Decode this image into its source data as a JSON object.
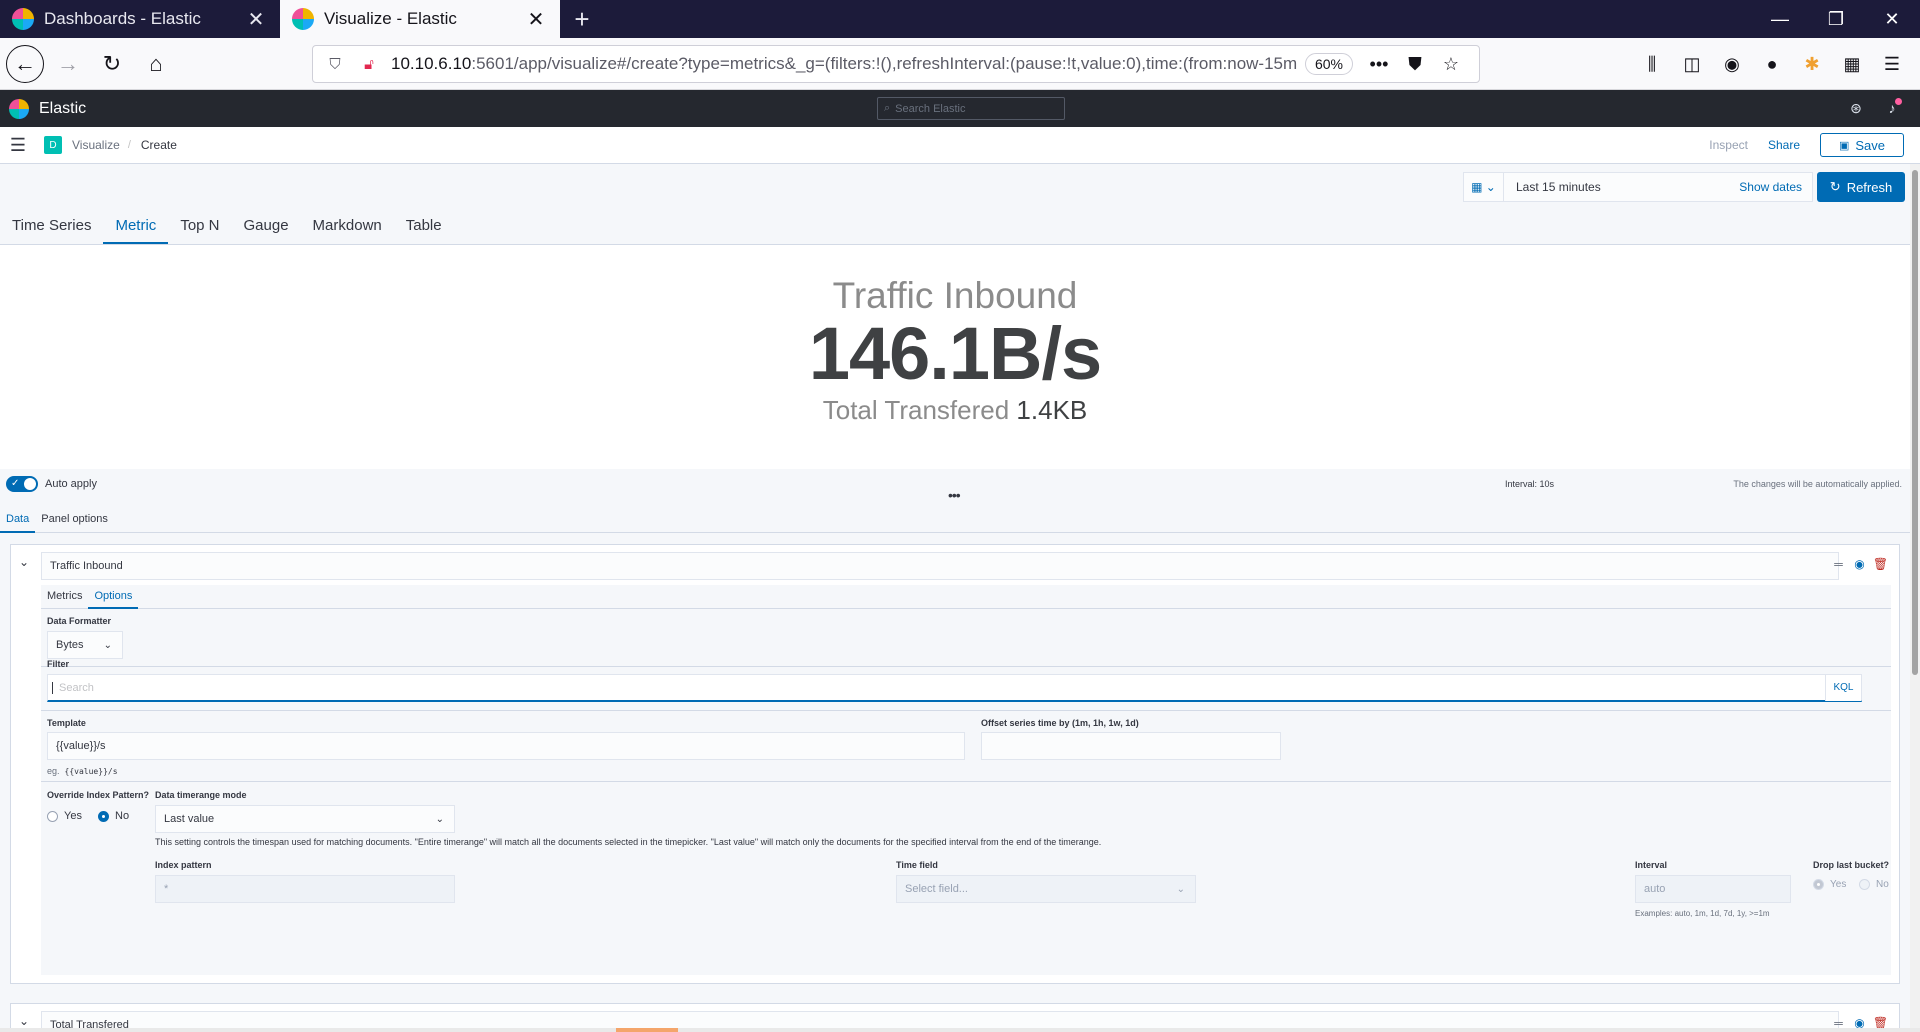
{
  "browser": {
    "tabs": [
      {
        "title": "Dashboards - Elastic",
        "active": false
      },
      {
        "title": "Visualize - Elastic",
        "active": true
      }
    ],
    "new_tab_icon": "plus-icon",
    "url_host": "10.10.6.10",
    "url_rest": ":5601/app/visualize#/create?type=metrics&_g=(filters:!(),refreshInterval:(pause:!t,value:0),time:(from:now-15m",
    "zoom": "60%"
  },
  "kibana": {
    "brand": "Elastic",
    "search_placeholder": "Search Elastic"
  },
  "breadcrumb": {
    "space": "D",
    "items": [
      "Visualize",
      "Create"
    ],
    "inspect": "Inspect",
    "share": "Share",
    "save": "Save"
  },
  "timepicker": {
    "range": "Last 15 minutes",
    "show_dates": "Show dates",
    "refresh": "Refresh"
  },
  "viz_tabs": [
    "Time Series",
    "Metric",
    "Top N",
    "Gauge",
    "Markdown",
    "Table"
  ],
  "viz_tab_active": "Metric",
  "metric": {
    "label": "Traffic Inbound",
    "value": "146.1B/s",
    "secondary_label": "Total Transfered",
    "secondary_value": "1.4KB"
  },
  "panel": {
    "auto_apply": "Auto apply",
    "auto_apply_on": true,
    "interval": "Interval: 10s",
    "auto_note": "The changes will be automatically applied.",
    "tabs": [
      "Data",
      "Panel options"
    ],
    "series": {
      "name": "Traffic Inbound",
      "tabs": [
        "Metrics",
        "Options"
      ],
      "data_formatter_label": "Data Formatter",
      "data_formatter_value": "Bytes",
      "filter_label": "Filter",
      "filter_placeholder": "Search",
      "kql": "KQL",
      "template_label": "Template",
      "template_value": "{{value}}/s",
      "template_hint_prefix": "eg.",
      "template_hint_code": "{{value}}/s",
      "offset_label": "Offset series time by (1m, 1h, 1w, 1d)",
      "override_label": "Override Index Pattern?",
      "override_yes": "Yes",
      "override_no": "No",
      "override_value": "No",
      "timerange_label": "Data timerange mode",
      "timerange_value": "Last value",
      "timerange_help": "This setting controls the timespan used for matching documents. \"Entire timerange\" will match all the documents selected in the timepicker. \"Last value\" will match only the documents for the specified interval from the end of the timerange.",
      "index_pattern_label": "Index pattern",
      "index_pattern_placeholder": "*",
      "time_field_label": "Time field",
      "time_field_placeholder": "Select field...",
      "interval_label": "Interval",
      "interval_placeholder": "auto",
      "interval_hint": "Examples: auto, 1m, 1d, 7d, 1y, >=1m",
      "drop_label": "Drop last bucket?",
      "drop_yes": "Yes",
      "drop_no": "No"
    },
    "second_series_name": "Total Transfered"
  },
  "colors": {
    "accent": "#006bb4",
    "danger": "#bd271e",
    "header_bg": "#25282f"
  }
}
